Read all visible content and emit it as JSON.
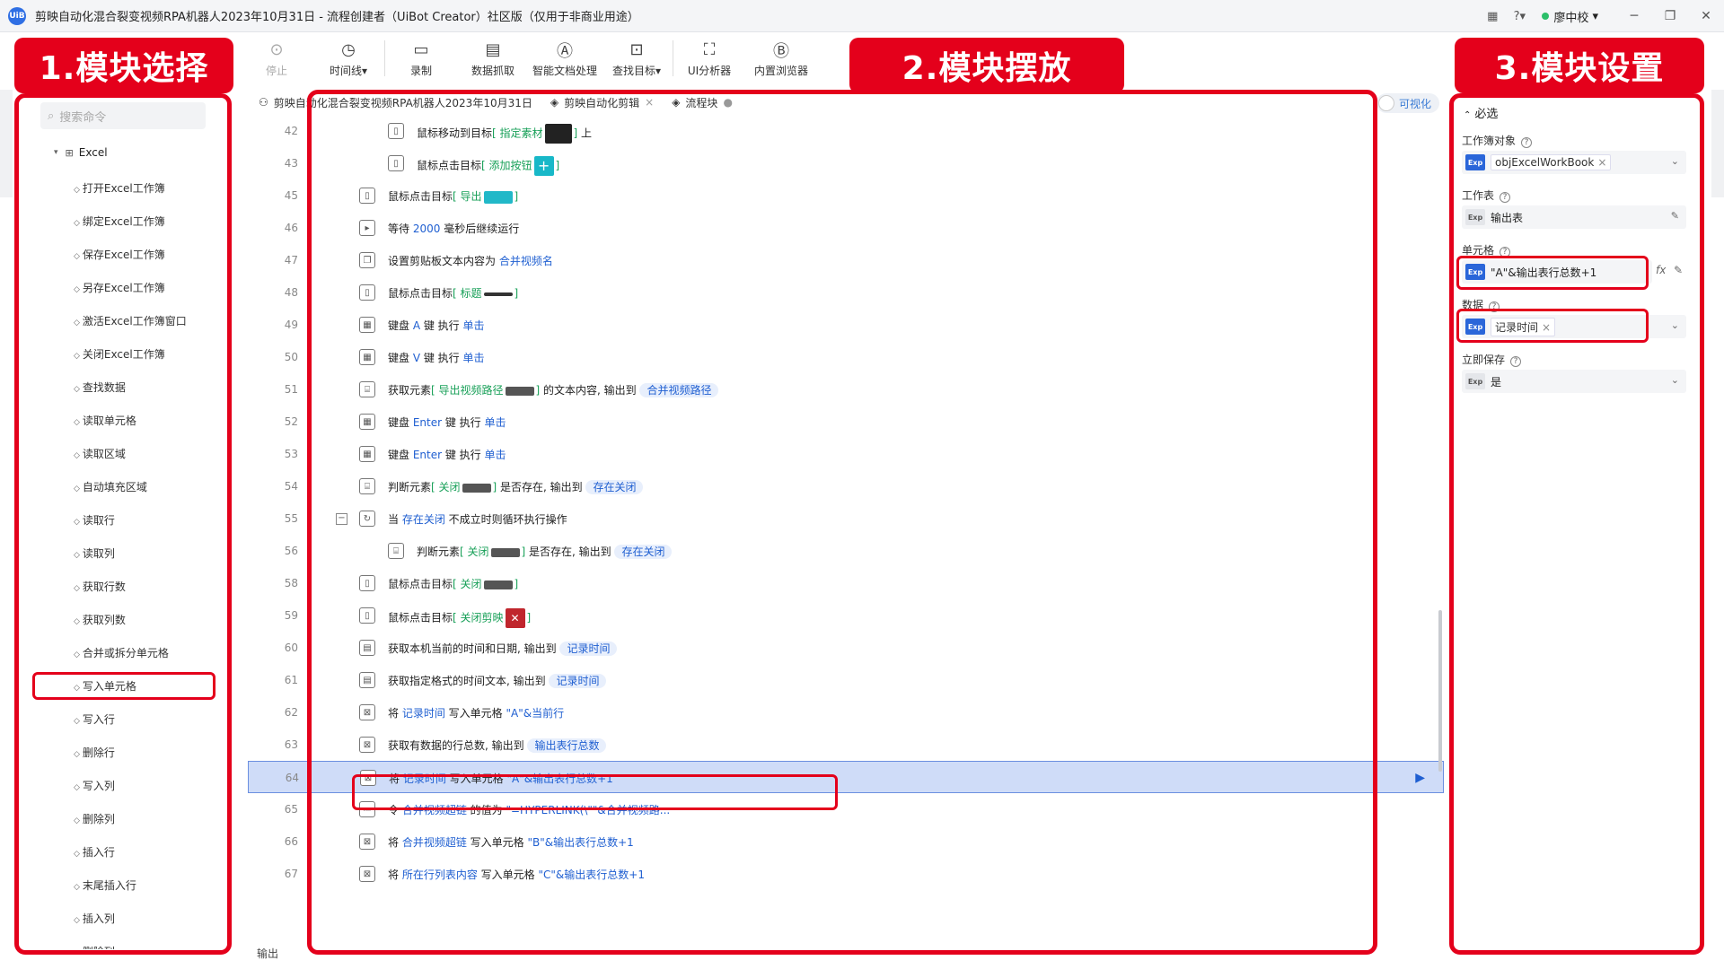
{
  "window": {
    "title": "剪映自动化混合裂变视频RPA机器人2023年10月31日 - 流程创建者（UiBot Creator）社区版（仅用于非商业用途）",
    "logo": "UiB",
    "user": "廖中校"
  },
  "toolbar": {
    "items": [
      {
        "icon": "stop-icon",
        "label": "停止"
      },
      {
        "icon": "timeline-icon",
        "label": "时间线▾"
      },
      {
        "icon": "record-icon",
        "label": "录制"
      },
      {
        "icon": "data-scrape-icon",
        "label": "数据抓取"
      },
      {
        "icon": "ai-doc-icon",
        "label": "智能文档处理"
      },
      {
        "icon": "find-target-icon",
        "label": "查找目标▾"
      },
      {
        "icon": "ui-analyzer-icon",
        "label": "UI分析器"
      },
      {
        "icon": "browser-icon",
        "label": "内置浏览器"
      }
    ]
  },
  "callouts": {
    "left": "1.模块选择",
    "middle": "2.模块摆放",
    "right": "3.模块设置"
  },
  "left_panel": {
    "search_placeholder": "搜索命令",
    "category": "Excel",
    "commands": [
      "打开Excel工作簿",
      "绑定Excel工作簿",
      "保存Excel工作簿",
      "另存Excel工作簿",
      "激活Excel工作簿窗口",
      "关闭Excel工作簿",
      "查找数据",
      "读取单元格",
      "读取区域",
      "自动填充区域",
      "读取行",
      "读取列",
      "获取行数",
      "获取列数",
      "合并或拆分单元格",
      "写入单元格",
      "写入行",
      "删除行",
      "写入列",
      "删除列",
      "插入行",
      "末尾插入行",
      "插入列",
      "删除列"
    ]
  },
  "tabs": [
    {
      "label": "剪映自动化混合裂变视频RPA机器人2023年10月31日",
      "icon": "flow-icon"
    },
    {
      "label": "剪映自动化剪辑",
      "icon": "layers-icon",
      "close": "×"
    },
    {
      "label": "流程块",
      "icon": "layers-icon",
      "close": "●"
    }
  ],
  "visualize_label": "可视化",
  "rows": [
    {
      "ln": "42",
      "indent": 1,
      "icon": "mouse",
      "parts": [
        [
          "t",
          "鼠标移动到目标"
        ],
        [
          "g",
          "[ 指定素材"
        ],
        [
          "img",
          "dark"
        ],
        [
          "g",
          "]"
        ],
        [
          "t",
          " 上"
        ]
      ]
    },
    {
      "ln": "43",
      "indent": 1,
      "icon": "mouse",
      "parts": [
        [
          "t",
          "鼠标点击目标"
        ],
        [
          "g",
          "[ 添加按钮"
        ],
        [
          "img",
          "plus"
        ],
        [
          "g",
          "]"
        ]
      ]
    },
    {
      "ln": "45",
      "indent": 0,
      "icon": "mouse",
      "parts": [
        [
          "t",
          "鼠标点击目标"
        ],
        [
          "g",
          "[ 导出"
        ],
        [
          "img",
          "export"
        ],
        [
          "g",
          "]"
        ]
      ]
    },
    {
      "ln": "46",
      "indent": 0,
      "icon": "wait",
      "parts": [
        [
          "t",
          "等待 "
        ],
        [
          "b",
          "2000"
        ],
        [
          "t",
          " 毫秒后继续运行"
        ]
      ]
    },
    {
      "ln": "47",
      "indent": 0,
      "icon": "clip",
      "parts": [
        [
          "t",
          "设置剪贴板文本内容为 "
        ],
        [
          "b",
          "合并视频名"
        ]
      ]
    },
    {
      "ln": "48",
      "indent": 0,
      "icon": "mouse",
      "parts": [
        [
          "t",
          "鼠标点击目标"
        ],
        [
          "g",
          "[ 标题"
        ],
        [
          "img",
          "line"
        ],
        [
          "g",
          "]"
        ]
      ]
    },
    {
      "ln": "49",
      "indent": 0,
      "icon": "kbd",
      "parts": [
        [
          "t",
          "键盘 "
        ],
        [
          "b",
          "A"
        ],
        [
          "t",
          " 键 执行 "
        ],
        [
          "b",
          "单击"
        ]
      ]
    },
    {
      "ln": "50",
      "indent": 0,
      "icon": "kbd",
      "parts": [
        [
          "t",
          "键盘 "
        ],
        [
          "b",
          "V"
        ],
        [
          "t",
          " 键 执行 "
        ],
        [
          "b",
          "单击"
        ]
      ]
    },
    {
      "ln": "51",
      "indent": 0,
      "icon": "elem",
      "parts": [
        [
          "t",
          "获取元素"
        ],
        [
          "g",
          "[ 导出视频路径"
        ],
        [
          "img",
          "bar"
        ],
        [
          "g",
          "]"
        ],
        [
          "t",
          " 的文本内容, 输出到 "
        ],
        [
          "c",
          "合并视频路径"
        ]
      ]
    },
    {
      "ln": "52",
      "indent": 0,
      "icon": "kbd",
      "parts": [
        [
          "t",
          "键盘 "
        ],
        [
          "b",
          "Enter"
        ],
        [
          "t",
          " 键 执行 "
        ],
        [
          "b",
          "单击"
        ]
      ]
    },
    {
      "ln": "53",
      "indent": 0,
      "icon": "kbd",
      "parts": [
        [
          "t",
          "键盘 "
        ],
        [
          "b",
          "Enter"
        ],
        [
          "t",
          " 键 执行 "
        ],
        [
          "b",
          "单击"
        ]
      ]
    },
    {
      "ln": "54",
      "indent": 0,
      "icon": "elem",
      "parts": [
        [
          "t",
          "判断元素"
        ],
        [
          "g",
          "[ 关闭"
        ],
        [
          "img",
          "bar"
        ],
        [
          "g",
          "]"
        ],
        [
          "t",
          " 是否存在, 输出到 "
        ],
        [
          "c",
          "存在关闭"
        ]
      ]
    },
    {
      "ln": "55",
      "indent": 0,
      "icon": "loop",
      "collapse": "−",
      "parts": [
        [
          "t",
          "当 "
        ],
        [
          "b",
          "存在关闭"
        ],
        [
          "t",
          " 不成立时则循环执行操作"
        ]
      ]
    },
    {
      "ln": "56",
      "indent": 1,
      "icon": "elem",
      "parts": [
        [
          "t",
          "判断元素"
        ],
        [
          "g",
          "[ 关闭"
        ],
        [
          "img",
          "bar"
        ],
        [
          "g",
          "]"
        ],
        [
          "t",
          " 是否存在, 输出到 "
        ],
        [
          "c",
          "存在关闭"
        ]
      ]
    },
    {
      "ln": "58",
      "indent": 0,
      "icon": "mouse",
      "parts": [
        [
          "t",
          "鼠标点击目标"
        ],
        [
          "g",
          "[ 关闭"
        ],
        [
          "img",
          "bar"
        ],
        [
          "g",
          "]"
        ]
      ]
    },
    {
      "ln": "59",
      "indent": 0,
      "icon": "mouse",
      "parts": [
        [
          "t",
          "鼠标点击目标"
        ],
        [
          "g",
          "[ 关闭剪映"
        ],
        [
          "img",
          "redx"
        ],
        [
          "g",
          "]"
        ]
      ]
    },
    {
      "ln": "60",
      "indent": 0,
      "icon": "cal",
      "parts": [
        [
          "t",
          "获取本机当前的时间和日期, 输出到 "
        ],
        [
          "c",
          "记录时间"
        ]
      ]
    },
    {
      "ln": "61",
      "indent": 0,
      "icon": "cal",
      "parts": [
        [
          "t",
          "获取指定格式的时间文本, 输出到 "
        ],
        [
          "c",
          "记录时间"
        ]
      ]
    },
    {
      "ln": "62",
      "indent": 0,
      "icon": "xls",
      "parts": [
        [
          "t",
          "将 "
        ],
        [
          "b",
          "记录时间"
        ],
        [
          "t",
          " 写入单元格 "
        ],
        [
          "b",
          "\"A\"&当前行"
        ]
      ]
    },
    {
      "ln": "63",
      "indent": 0,
      "icon": "xls",
      "parts": [
        [
          "t",
          "获取有数据的行总数, 输出到 "
        ],
        [
          "c",
          "输出表行总数"
        ]
      ]
    },
    {
      "ln": "64",
      "indent": 0,
      "icon": "xls",
      "highlight": true,
      "parts": [
        [
          "t",
          "将 "
        ],
        [
          "b",
          "记录时间"
        ],
        [
          "t",
          " 写入单元格 "
        ],
        [
          "b",
          "\"A\"&输出表行总数+1"
        ]
      ]
    },
    {
      "ln": "65",
      "indent": 0,
      "icon": "let",
      "parts": [
        [
          "t",
          "令 "
        ],
        [
          "b",
          "合并视频超链"
        ],
        [
          "t",
          " 的值为 "
        ],
        [
          "b",
          "\"=HYPERLINK(\\\"\"&合并视频路..."
        ]
      ]
    },
    {
      "ln": "66",
      "indent": 0,
      "icon": "xls",
      "parts": [
        [
          "t",
          "将 "
        ],
        [
          "b",
          "合并视频超链"
        ],
        [
          "t",
          " 写入单元格 "
        ],
        [
          "b",
          "\"B\"&输出表行总数+1"
        ]
      ]
    },
    {
      "ln": "67",
      "indent": 0,
      "icon": "xls",
      "parts": [
        [
          "t",
          "将 "
        ],
        [
          "b",
          "所在行列表内容"
        ],
        [
          "t",
          " 写入单元格 "
        ],
        [
          "b",
          "\"C\"&输出表行总数+1"
        ]
      ]
    }
  ],
  "output_label": "输出",
  "right_panel": {
    "section": "必选",
    "fields": [
      {
        "label": "工作簿对象",
        "exp": "Exp",
        "value": "objExcelWorkBook",
        "tag": true,
        "dropdown": true
      },
      {
        "label": "工作表",
        "exp": "Exp",
        "value": "输出表",
        "grey": true,
        "edit": true
      },
      {
        "label": "单元格",
        "exp": "Exp",
        "value": "\"A\"&输出表行总数+1",
        "fx": true
      },
      {
        "label": "数据",
        "exp": "Exp",
        "value": "记录时间",
        "tag": true,
        "dropdown": true
      },
      {
        "label": "立即保存",
        "exp": "Exp",
        "value": "是",
        "grey": true,
        "dropdown": true
      }
    ]
  },
  "colors": {
    "accent": "#e4001b",
    "link": "#1f5fd1",
    "target": "#18a058",
    "highlight": "#cfdcf8"
  }
}
